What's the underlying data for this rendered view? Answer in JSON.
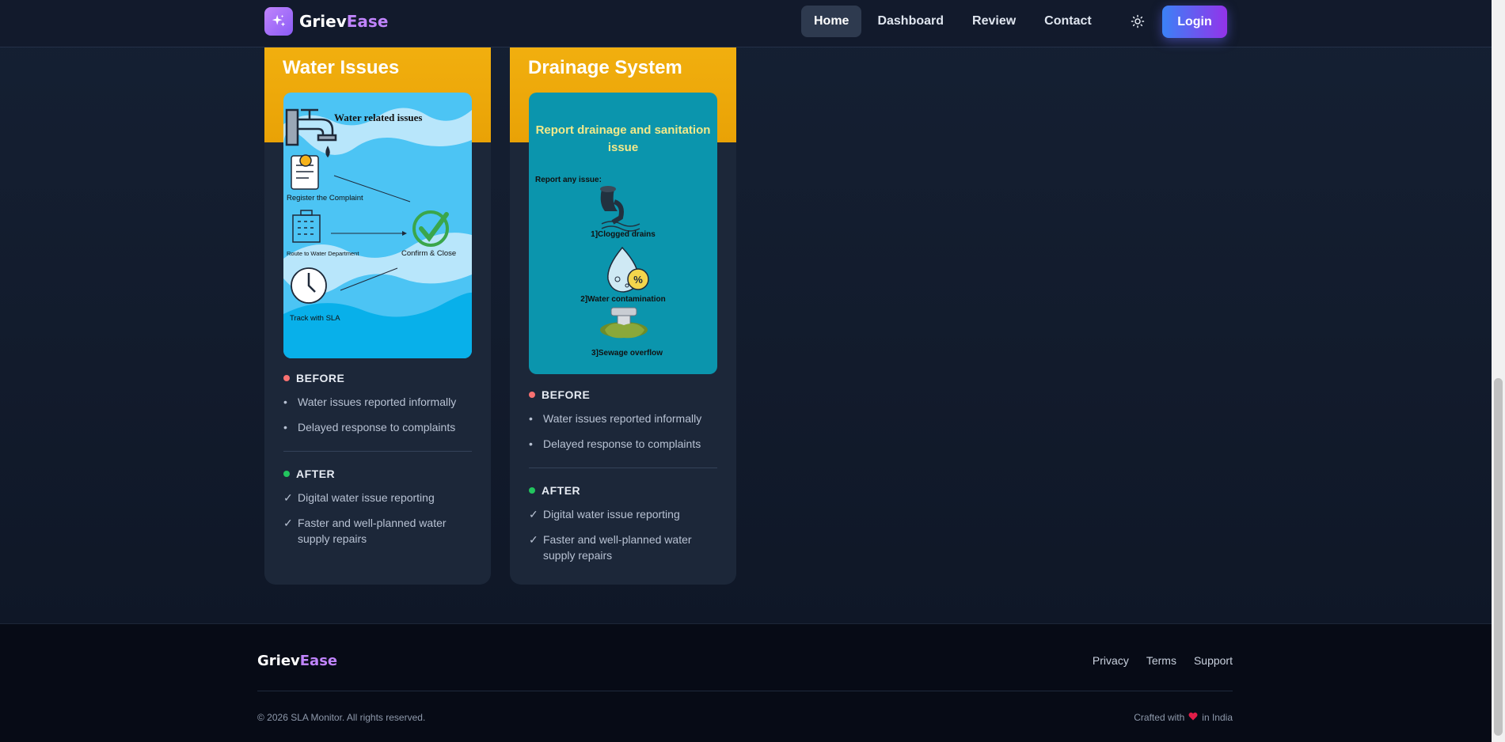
{
  "header": {
    "brand_primary": "Griev",
    "brand_accent": "Ease",
    "nav": [
      {
        "label": "Home",
        "active": true
      },
      {
        "label": "Dashboard",
        "active": false
      },
      {
        "label": "Review",
        "active": false
      },
      {
        "label": "Contact",
        "active": false
      }
    ],
    "login_label": "Login",
    "theme_icon": "sun-icon"
  },
  "cards": [
    {
      "title": "Water Issues",
      "image": {
        "heading": "Water related issues",
        "steps": [
          "Register the Complaint",
          "Route to Water Department",
          "Confirm & Close",
          "Track with SLA"
        ]
      },
      "before_label": "BEFORE",
      "before": [
        "Water issues reported informally",
        "Delayed response to complaints"
      ],
      "after_label": "AFTER",
      "after": [
        "Digital water issue reporting",
        "Faster and well-planned water supply repairs"
      ]
    },
    {
      "title": "Drainage System",
      "image": {
        "heading": "Report drainage and sanitation issue",
        "subheading": "Report any issue:",
        "items": [
          "1]Clogged drains",
          "2]Water contamination",
          "3]Sewage overflow"
        ]
      },
      "before_label": "BEFORE",
      "before": [
        "Water issues reported informally",
        "Delayed response to complaints"
      ],
      "after_label": "AFTER",
      "after": [
        "Digital water issue reporting",
        "Faster and well-planned water supply repairs"
      ]
    }
  ],
  "footer": {
    "brand_primary": "Griev",
    "brand_accent": "Ease",
    "links": [
      "Privacy",
      "Terms",
      "Support"
    ],
    "copyright": "© 2026 SLA Monitor. All rights reserved.",
    "crafted_prefix": "Crafted with",
    "crafted_suffix": "in India"
  },
  "colors": {
    "accent_purple": "#c084fc",
    "card_header": "#f4b311",
    "login_gradient_start": "#3b82f6",
    "login_gradient_end": "#9333ea"
  }
}
